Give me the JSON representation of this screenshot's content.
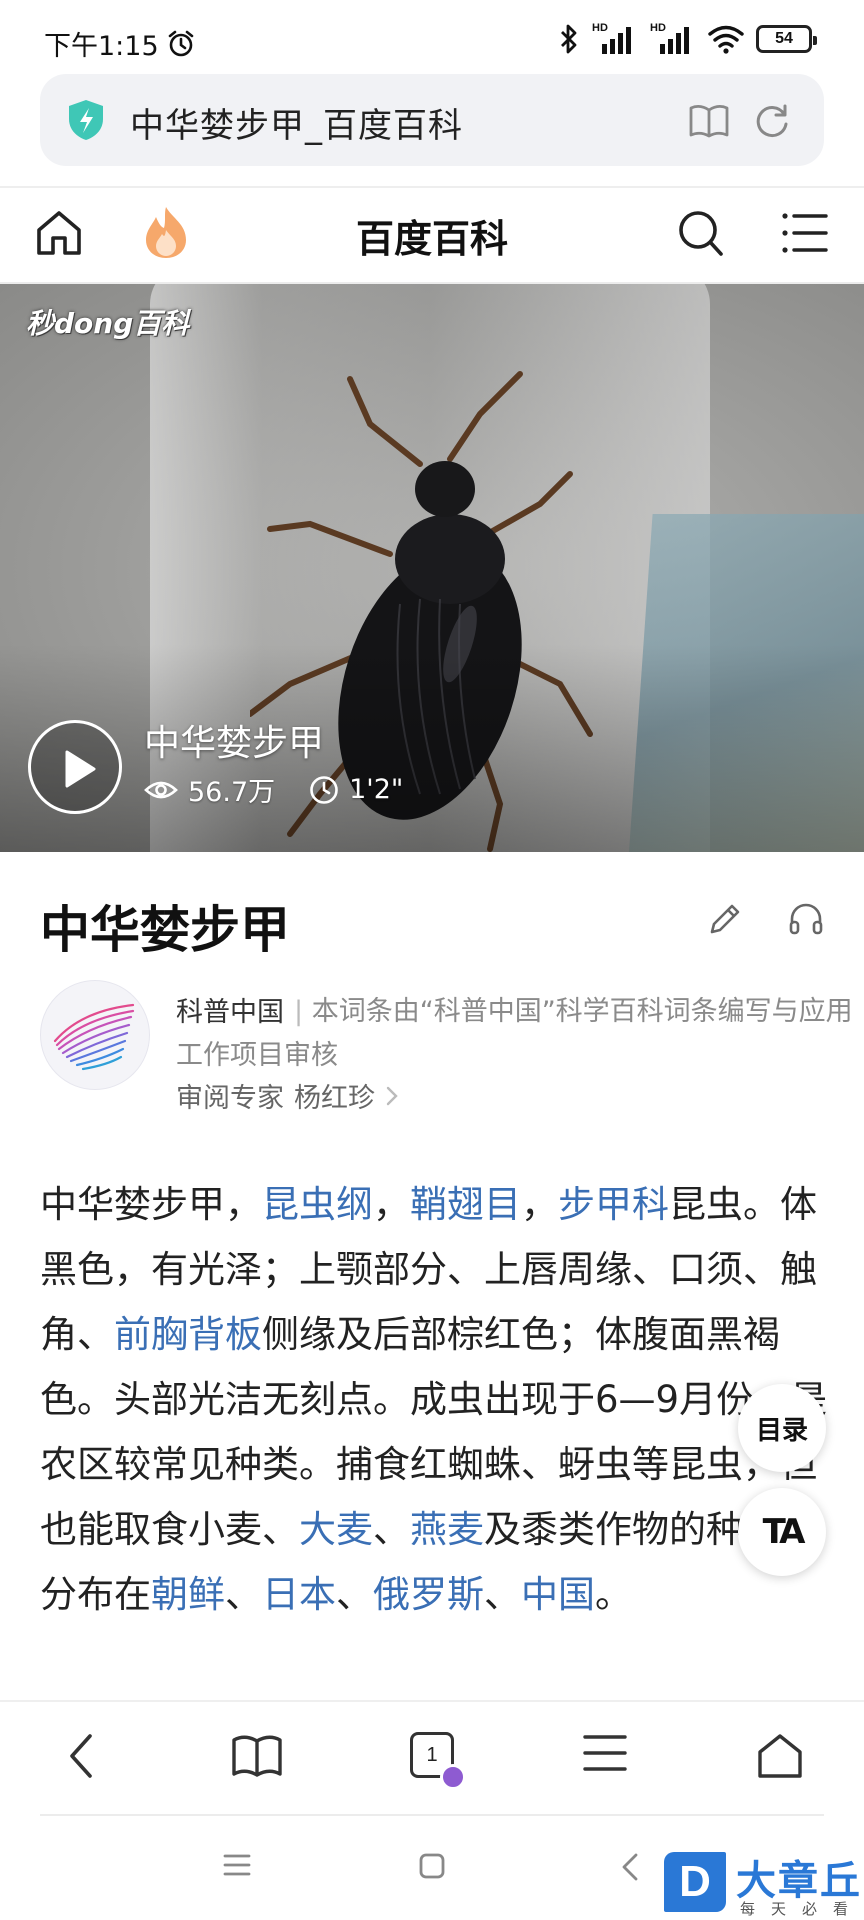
{
  "status_bar": {
    "time": "下午1:15",
    "hd1": "HD",
    "hd2": "HD",
    "battery": "54"
  },
  "address_bar": {
    "url_title": "中华婪步甲_百度百科"
  },
  "site_nav": {
    "title": "百度百科"
  },
  "video": {
    "watermark": "秒dong百科",
    "title": "中华婪步甲",
    "views": "56.7万",
    "duration": "1'2\""
  },
  "article": {
    "title": "中华婪步甲",
    "source": {
      "name": "科普中国",
      "separator": "|",
      "description": "本词条由“科普中国”科学百科词条编写与应用工作项目审核",
      "reviewer_label": "审阅专家",
      "reviewer_name": "杨红珍"
    },
    "body": {
      "p1": "中华婪步甲，",
      "link_kunchong": "昆虫纲",
      "comma1": "，",
      "link_qiaochi": "鞘翅目",
      "comma2": "，",
      "link_bujia": "步甲科",
      "p2": "昆虫。体黑色，有光泽；上颚部分、上唇周缘、口须、触角、",
      "link_qianxiong": "前胸背板",
      "p3": "侧缘及后部棕红色；体腹面黑褐色。头部光洁无刻点。成虫出现于6—9月份，是农区较常见种类。捕食红蜘蛛、蚜虫等昆虫，但也能取食小麦、",
      "link_damai": "大麦",
      "dun1": "、",
      "link_yanmai": "燕麦",
      "p4": "及黍类作物的种子。分布在",
      "link_chaoxian": "朝鲜",
      "dun2": "、",
      "link_riben": "日本",
      "dun3": "、",
      "link_eluosi": "俄罗斯",
      "dun4": "、",
      "link_zhongguo": "中国",
      "end": "。"
    }
  },
  "floating": {
    "toc_label": "目录",
    "font_label": "TA"
  },
  "bottom_bar": {
    "tab_count": "1"
  },
  "brand": {
    "letter": "D",
    "name": "大章丘",
    "slogan": "每天必看"
  }
}
